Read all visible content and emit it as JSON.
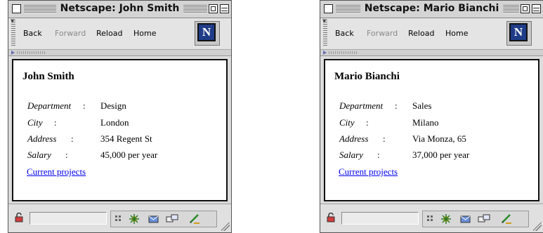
{
  "windows": [
    {
      "title": "Netscape: John Smith",
      "toolbar": {
        "back": "Back",
        "forward": "Forward",
        "reload": "Reload",
        "home": "Home",
        "logo": "N"
      },
      "employee": {
        "name": "John Smith",
        "department_label": "Department",
        "department": "Design",
        "city_label": "City",
        "city": "London",
        "address_label": "Address",
        "address": "354 Regent St",
        "salary_label": "Salary",
        "salary": "45,000 per year",
        "link": "Current projects"
      }
    },
    {
      "title": "Netscape: Mario Bianchi",
      "toolbar": {
        "back": "Back",
        "forward": "Forward",
        "reload": "Reload",
        "home": "Home",
        "logo": "N"
      },
      "employee": {
        "name": "Mario Bianchi",
        "department_label": "Department",
        "department": "Sales",
        "city_label": "City",
        "city": "Milano",
        "address_label": "Address",
        "address": "Via Monza, 65",
        "salary_label": "Salary",
        "salary": "37,000 per year",
        "link": "Current projects"
      }
    }
  ],
  "colon": ":",
  "colors": {
    "link": "#0000ee",
    "logo_bg": "#1f3c88",
    "chrome": "#dcdcdc"
  }
}
